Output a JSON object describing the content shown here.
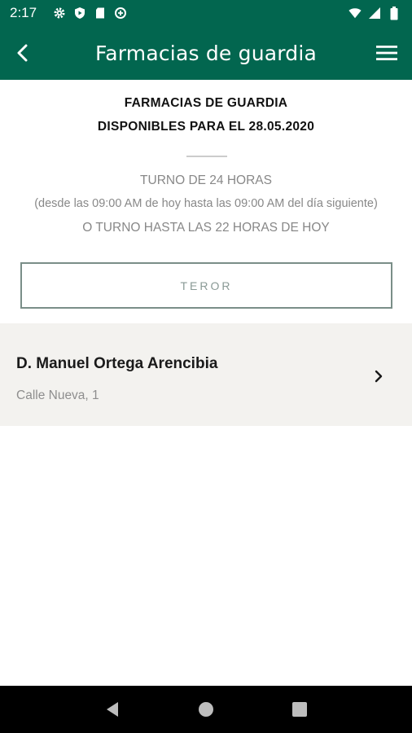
{
  "status_bar": {
    "time": "2:17",
    "icons": [
      "settings-icon",
      "play-protect-icon",
      "sd-card-icon",
      "data-saver-icon"
    ],
    "right_icons": [
      "wifi-icon",
      "signal-icon",
      "battery-icon"
    ]
  },
  "app_bar": {
    "title": "Farmacias de guardia",
    "back_icon": "chevron-left-icon",
    "menu_icon": "hamburger-menu-icon"
  },
  "header": {
    "line1": "FARMACIAS DE GUARDIA",
    "line2": "DISPONIBLES PARA EL 28.05.2020"
  },
  "shift_info": {
    "line1": "TURNO DE 24 HORAS",
    "line2": "(desde las 09:00 AM de hoy hasta las 09:00 AM del día siguiente)",
    "line3": "O TURNO HASTA LAS 22 HORAS DE HOY"
  },
  "town_selector": {
    "label": "TEROR"
  },
  "pharmacies": [
    {
      "name": "D. Manuel Ortega Arencibia",
      "address": "Calle Nueva, 1"
    }
  ],
  "colors": {
    "primary": "#02664f",
    "list_background": "#f3f2ef",
    "muted_text": "#888888"
  }
}
